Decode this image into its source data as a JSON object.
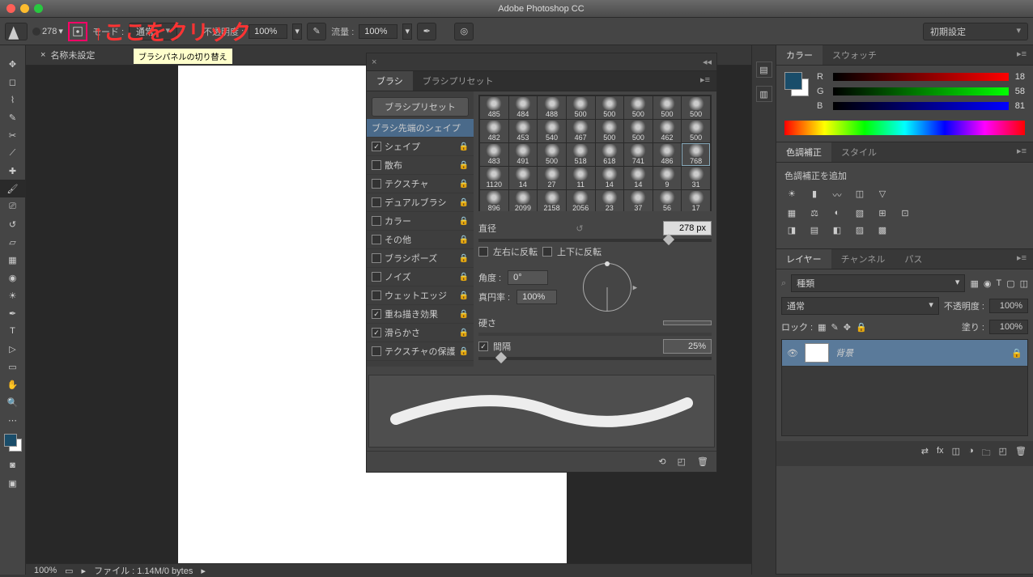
{
  "app_title": "Adobe Photoshop CC",
  "option_bar": {
    "brush_size": "278",
    "mode_label": "モード :",
    "mode_value": "通常",
    "opacity_label": "不透明度 :",
    "opacity_value": "100%",
    "flow_label": "流量 :",
    "flow_value": "100%",
    "workspace": "初期設定"
  },
  "doc_tab": "名称未設定",
  "tooltip": "ブラシパネルの切り替え",
  "annotation": "↑ここをクリック",
  "brush_panel": {
    "tabs": [
      "ブラシ",
      "ブラシプリセット"
    ],
    "preset_btn": "ブラシプリセット",
    "tip_shape": "ブラシ先端のシェイプ",
    "options": [
      {
        "label": "シェイプ",
        "checked": true
      },
      {
        "label": "散布",
        "checked": false
      },
      {
        "label": "テクスチャ",
        "checked": false
      },
      {
        "label": "デュアルブラシ",
        "checked": false
      },
      {
        "label": "カラー",
        "checked": false
      },
      {
        "label": "その他",
        "checked": false
      },
      {
        "label": "ブラシポーズ",
        "checked": false
      },
      {
        "label": "ノイズ",
        "checked": false
      },
      {
        "label": "ウェットエッジ",
        "checked": false
      },
      {
        "label": "重ね描き効果",
        "checked": true
      },
      {
        "label": "滑らかさ",
        "checked": true
      },
      {
        "label": "テクスチャの保護",
        "checked": false
      }
    ],
    "grid": [
      "485",
      "484",
      "488",
      "500",
      "500",
      "500",
      "500",
      "500",
      "482",
      "453",
      "540",
      "467",
      "500",
      "500",
      "462",
      "500",
      "483",
      "491",
      "500",
      "518",
      "618",
      "741",
      "486",
      "768",
      "1120",
      "14",
      "27",
      "11",
      "14",
      "14",
      "9",
      "31",
      "896",
      "2099",
      "2158",
      "2056",
      "23",
      "37",
      "56",
      "17"
    ],
    "diameter_label": "直径",
    "diameter_value": "278 px",
    "flip_x": "左右に反転",
    "flip_y": "上下に反転",
    "angle_label": "角度 :",
    "angle_value": "0°",
    "roundness_label": "真円率 :",
    "roundness_value": "100%",
    "hardness_label": "硬さ",
    "spacing_label": "間隔",
    "spacing_value": "25%"
  },
  "color_panel": {
    "tabs": [
      "カラー",
      "スウォッチ"
    ],
    "r": 18,
    "g": 58,
    "b": 81
  },
  "adjust_panel": {
    "tabs": [
      "色調補正",
      "スタイル"
    ],
    "add": "色調補正を追加"
  },
  "layer_panel": {
    "tabs": [
      "レイヤー",
      "チャンネル",
      "パス"
    ],
    "kind": "種類",
    "blend": "通常",
    "opacity_label": "不透明度 :",
    "opacity": "100%",
    "lock_label": "ロック :",
    "fill_label": "塗り :",
    "fill": "100%",
    "layer_name": "背景"
  },
  "status": {
    "zoom": "100%",
    "file": "ファイル : 1.14M/0 bytes"
  }
}
